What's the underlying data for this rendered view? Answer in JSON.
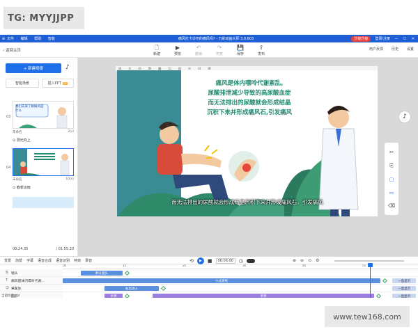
{
  "watermarks": {
    "top_left": "TG: MYYJJPP",
    "bottom_right": "www.tew168.com"
  },
  "titlebar": {
    "logo": "≡",
    "menu": [
      "文件",
      "编辑",
      "帮助",
      "智能"
    ],
    "title": "痛风打卡诊疗的痛风吗? - 万彩动画大师 3.0.603",
    "upgrade": "升级升级",
    "login": "登录/注册",
    "controls": [
      "—",
      "☐",
      "✕"
    ]
  },
  "toolbar": {
    "back": "返回主页",
    "tools": [
      {
        "icon": "🗋",
        "label": "新建",
        "dim": false
      },
      {
        "icon": "▶",
        "label": "预览",
        "dim": false
      },
      {
        "icon": "↶",
        "label": "撤销",
        "dim": true
      },
      {
        "icon": "↷",
        "label": "恢复",
        "dim": true
      },
      {
        "icon": "💾",
        "label": "保存",
        "dim": false
      },
      {
        "icon": "⇪",
        "label": "发布",
        "dim": false
      }
    ],
    "right": [
      "用户反馈",
      "历史",
      "设置"
    ]
  },
  "left_panel": {
    "new_scene": "+ 新建场景",
    "ai_scene": "智能场景",
    "insert_ppt": "插入PPT",
    "vip_badge": "VIP",
    "scenes": [
      {
        "num": "03",
        "thumb_text": "我们先来了解痛风是什么",
        "name": "未命名",
        "duration": "2(s)",
        "transition": "洞光向上"
      },
      {
        "num": "04",
        "thumb_text": "",
        "name": "未命名",
        "duration": "10(s)",
        "transition": "春季淡雨"
      }
    ],
    "time_current": "00:24.35",
    "time_total": "/ 01:55.20"
  },
  "canvas": {
    "ruler_icons": [
      "⊞",
      "≡",
      "⊟",
      "⊠",
      "▦",
      "⊡",
      "⊞",
      "≡",
      "⊟",
      "⊠"
    ],
    "slide_text_lines": [
      "痛风是体内嘌呤代谢紊乱,",
      "尿酸排泄减少导致的高尿酸血症",
      "而无法排出的尿酸就会形成结晶",
      "沉积下来并形成痛风石,引发痛风"
    ],
    "subtitle": "而无法排出的尿酸就会形成结晶沉积下来并形成痛风石，引发痛风",
    "music_icon": "♪"
  },
  "side_tools": [
    "✂",
    "⎘",
    "▢",
    "▭",
    "⌫"
  ],
  "timeline_toolbar": {
    "items": [
      "背景",
      "前景",
      "字幕",
      "语音合成",
      "语音识别",
      "特效",
      "录音"
    ],
    "current_time": "00:06.00",
    "zoom_icons": [
      "⊕",
      "⊖",
      "⊙",
      "⚙"
    ]
  },
  "timeline": {
    "ruler_ticks": [
      "0s",
      "1s",
      "2s",
      "3s",
      "4s",
      "5s",
      "6s"
    ],
    "tracks": [
      {
        "label": "镜头",
        "icon": "⎘",
        "clips": [
          {
            "text": "默认镜头",
            "start": 0.3,
            "end": 1.0,
            "style": "blue"
          }
        ]
      },
      {
        "label": "痛风是体内嘌呤代谢…",
        "icon": "T",
        "clips": [
          {
            "text": "小过渡线",
            "start": 0.0,
            "end": 5.3,
            "style": "blue"
          },
          {
            "text": "一直显示",
            "start": 5.5,
            "end": 5.9,
            "style": "light"
          }
        ]
      },
      {
        "label": "男医生",
        "icon": "☺",
        "clips": [
          {
            "text": "右出进入",
            "start": 0.7,
            "end": 1.6,
            "style": "blue"
          },
          {
            "text": "一直显示",
            "start": 5.5,
            "end": 5.9,
            "style": "light"
          }
        ]
      },
      {
        "label": "圆形",
        "icon": "○",
        "clips": [
          {
            "text": "手势",
            "start": 0.7,
            "end": 1.0,
            "style": "purple"
          },
          {
            "text": "手势",
            "start": 1.5,
            "end": 5.2,
            "style": "purple"
          },
          {
            "text": "一直显示",
            "start": 5.5,
            "end": 5.9,
            "style": "light"
          }
        ]
      },
      {
        "label": "画廊",
        "icon": "▢",
        "clips": [
          {
            "text": "渐变进入",
            "start": 2.8,
            "end": 3.6,
            "style": "blue"
          },
          {
            "text": "一直显示",
            "start": 5.5,
            "end": 5.9,
            "style": "light"
          }
        ]
      }
    ],
    "scene_count": "当前场景: 04"
  }
}
